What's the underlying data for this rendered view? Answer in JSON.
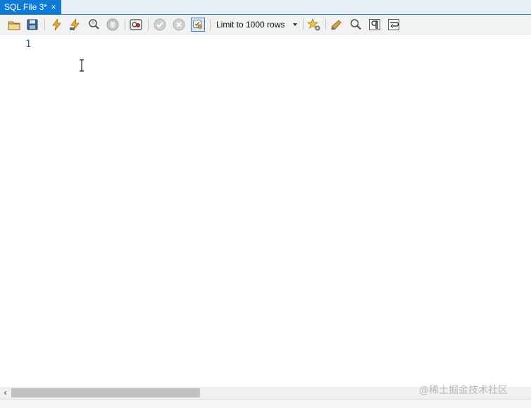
{
  "tab": {
    "label": "SQL File 3*",
    "close_glyph": "×"
  },
  "toolbar": {
    "buttons": [
      {
        "name": "open-folder-icon"
      },
      {
        "name": "save-icon"
      },
      {
        "name": "execute-lightning-icon"
      },
      {
        "name": "execute-current-statement-icon"
      },
      {
        "name": "explain-magnifier-icon"
      },
      {
        "name": "stop-hand-icon"
      },
      {
        "name": "toggle-continue-on-error-icon"
      },
      {
        "name": "commit-check-icon"
      },
      {
        "name": "rollback-x-icon"
      },
      {
        "name": "autocommit-toggle-icon"
      },
      {
        "name": "add-snippet-star-icon"
      },
      {
        "name": "beautify-brush-icon"
      },
      {
        "name": "find-magnifier-icon"
      },
      {
        "name": "invisible-chars-pilcrow-icon"
      },
      {
        "name": "word-wrap-icon"
      }
    ],
    "limit_select": {
      "value": "Limit to 1000 rows"
    }
  },
  "editor": {
    "line_numbers": [
      "1"
    ]
  },
  "scrollbar": {
    "left_arrow": "‹"
  },
  "watermark": {
    "text": "@稀土掘金技术社区"
  },
  "colors": {
    "tab_active": "#0f7bd8",
    "line_number": "#2f5f8f",
    "toolbar_bg": "#f2f2f2"
  }
}
